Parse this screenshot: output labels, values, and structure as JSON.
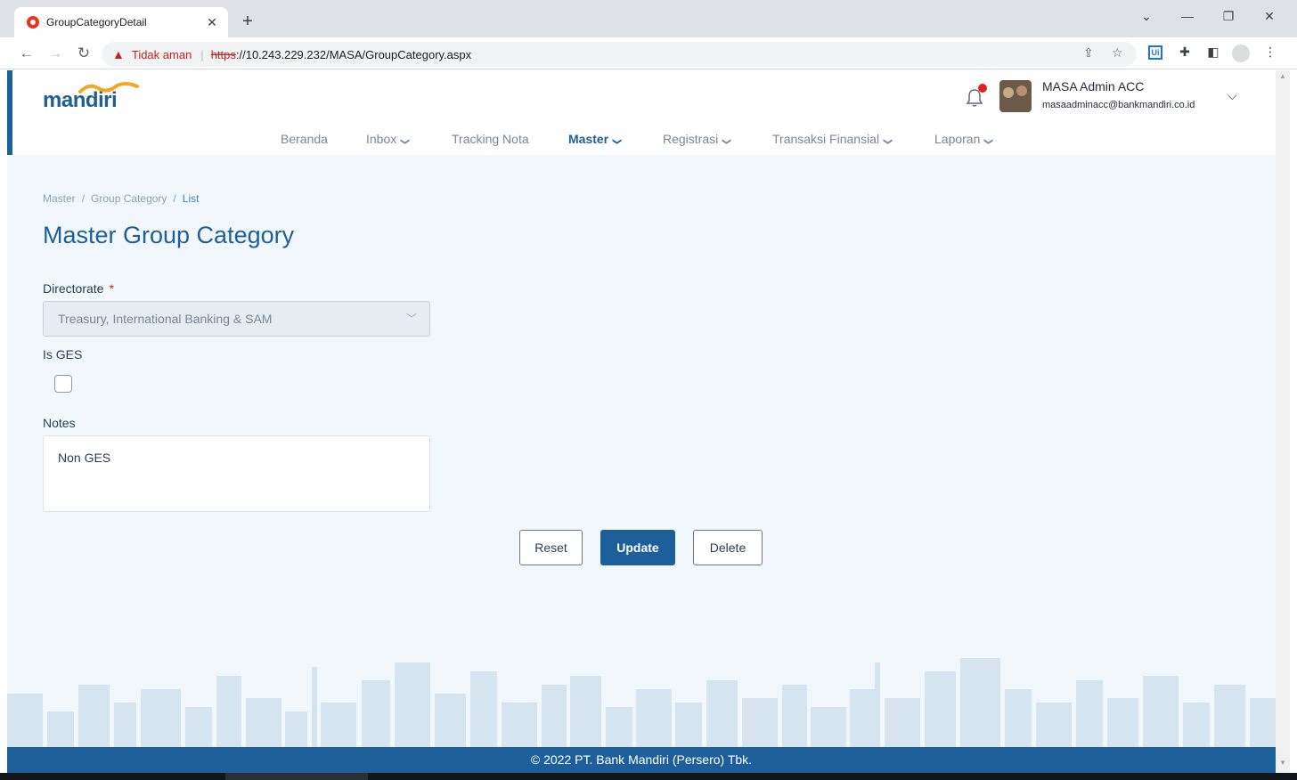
{
  "browser": {
    "tab_title": "GroupCategoryDetail",
    "tab_close": "✕",
    "new_tab": "+",
    "not_secure": "Tidak aman",
    "url_scheme": "https",
    "url_rest": "://10.243.229.232/MASA/GroupCategory.aspx",
    "ext_ui": "Ui"
  },
  "header": {
    "logo": "mandiri",
    "user_name": "MASA Admin ACC",
    "user_email": "masaadminacc@bankmandiri.co.id"
  },
  "nav": {
    "items": [
      {
        "label": "Beranda"
      },
      {
        "label": "Inbox"
      },
      {
        "label": "Tracking Nota"
      },
      {
        "label": "Master"
      },
      {
        "label": "Registrasi"
      },
      {
        "label": "Transaksi Finansial"
      },
      {
        "label": "Laporan"
      }
    ]
  },
  "breadcrumb": [
    "Master",
    "Group Category",
    "List"
  ],
  "page_title": "Master Group Category",
  "form": {
    "directorate_label": "Directorate",
    "required_mark": "*",
    "directorate_value": "Treasury, International Banking & SAM",
    "is_ges_label": "Is GES",
    "is_ges_checked": false,
    "notes_label": "Notes",
    "notes_value": "Non GES"
  },
  "buttons": {
    "reset": "Reset",
    "update": "Update",
    "delete": "Delete"
  },
  "footer": "© 2022 PT. Bank Mandiri (Persero) Tbk.",
  "colors": {
    "brand": "#1d5f9a",
    "accent": "#f5a623",
    "background": "#f1f7fb"
  }
}
